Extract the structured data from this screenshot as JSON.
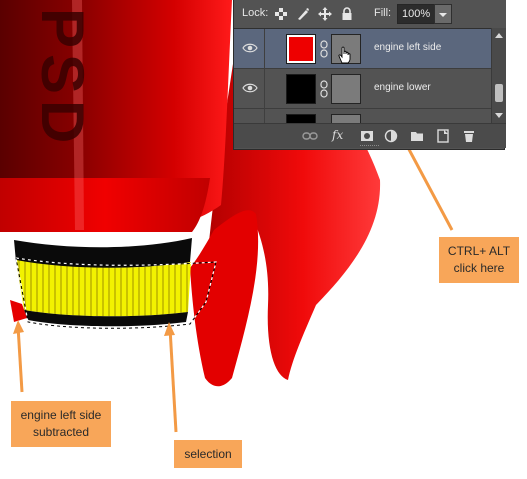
{
  "layers_panel": {
    "lock_label": "Lock:",
    "lock_icons": [
      "lock-transparent-pixels-icon",
      "lock-image-pixels-icon",
      "lock-position-icon",
      "lock-all-icon"
    ],
    "fill_label": "Fill:",
    "fill_value": "100%",
    "layers": [
      {
        "name": "engine left side",
        "selected": true,
        "thumb_color": "#ee0000"
      },
      {
        "name": "engine lower",
        "selected": false,
        "thumb_color": "#000000"
      }
    ],
    "footer_icons": [
      "link-layers-icon",
      "fx-icon",
      "add-mask-icon",
      "adjustment-layer-icon",
      "new-group-icon",
      "new-layer-icon",
      "delete-layer-icon"
    ],
    "fx_label": "fx"
  },
  "artwork": {
    "rocket_text": "PSD",
    "colors": {
      "rocket_red": "#e60000",
      "band_yellow": "#f2f200",
      "band_black": "#0a0a0a"
    }
  },
  "callouts": {
    "ctrl_alt": [
      "CTRL+ ALT",
      "click here"
    ],
    "engine_left": [
      "engine left side",
      "subtracted"
    ],
    "selection": "selection",
    "color": "#f8a659",
    "arrow_color": "#f39a45"
  }
}
